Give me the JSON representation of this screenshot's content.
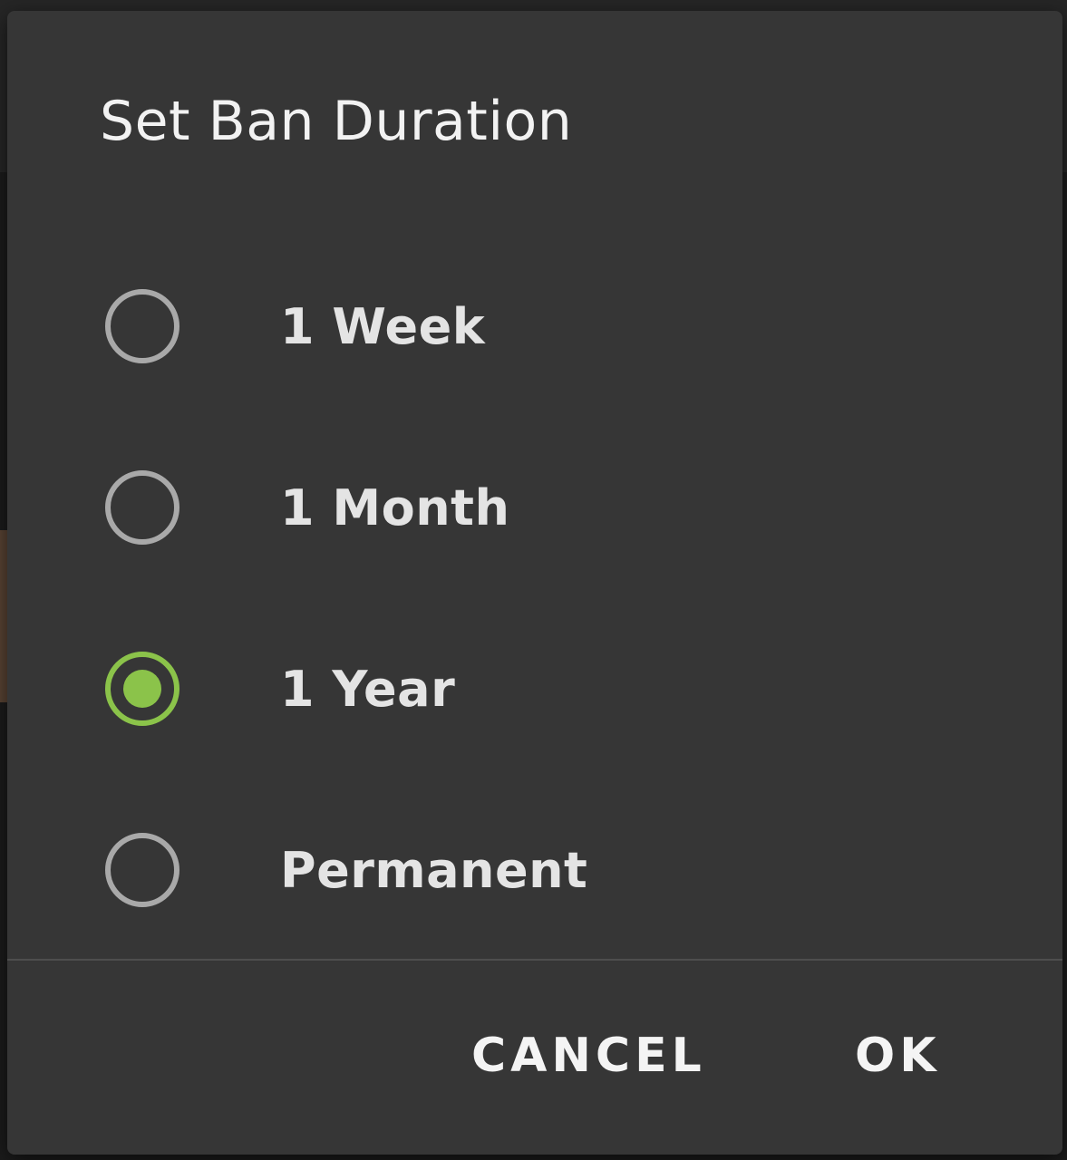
{
  "dialog": {
    "title": "Set Ban Duration",
    "options": [
      {
        "label": "1 Week",
        "selected": false
      },
      {
        "label": "1 Month",
        "selected": false
      },
      {
        "label": "1 Year",
        "selected": true
      },
      {
        "label": "Permanent",
        "selected": false
      }
    ],
    "buttons": {
      "cancel_label": "CANCEL",
      "ok_label": "OK"
    }
  },
  "colors": {
    "dialog_background": "#363636",
    "accent": "#8bc34a",
    "radio_unchecked": "#a9a9a9"
  }
}
